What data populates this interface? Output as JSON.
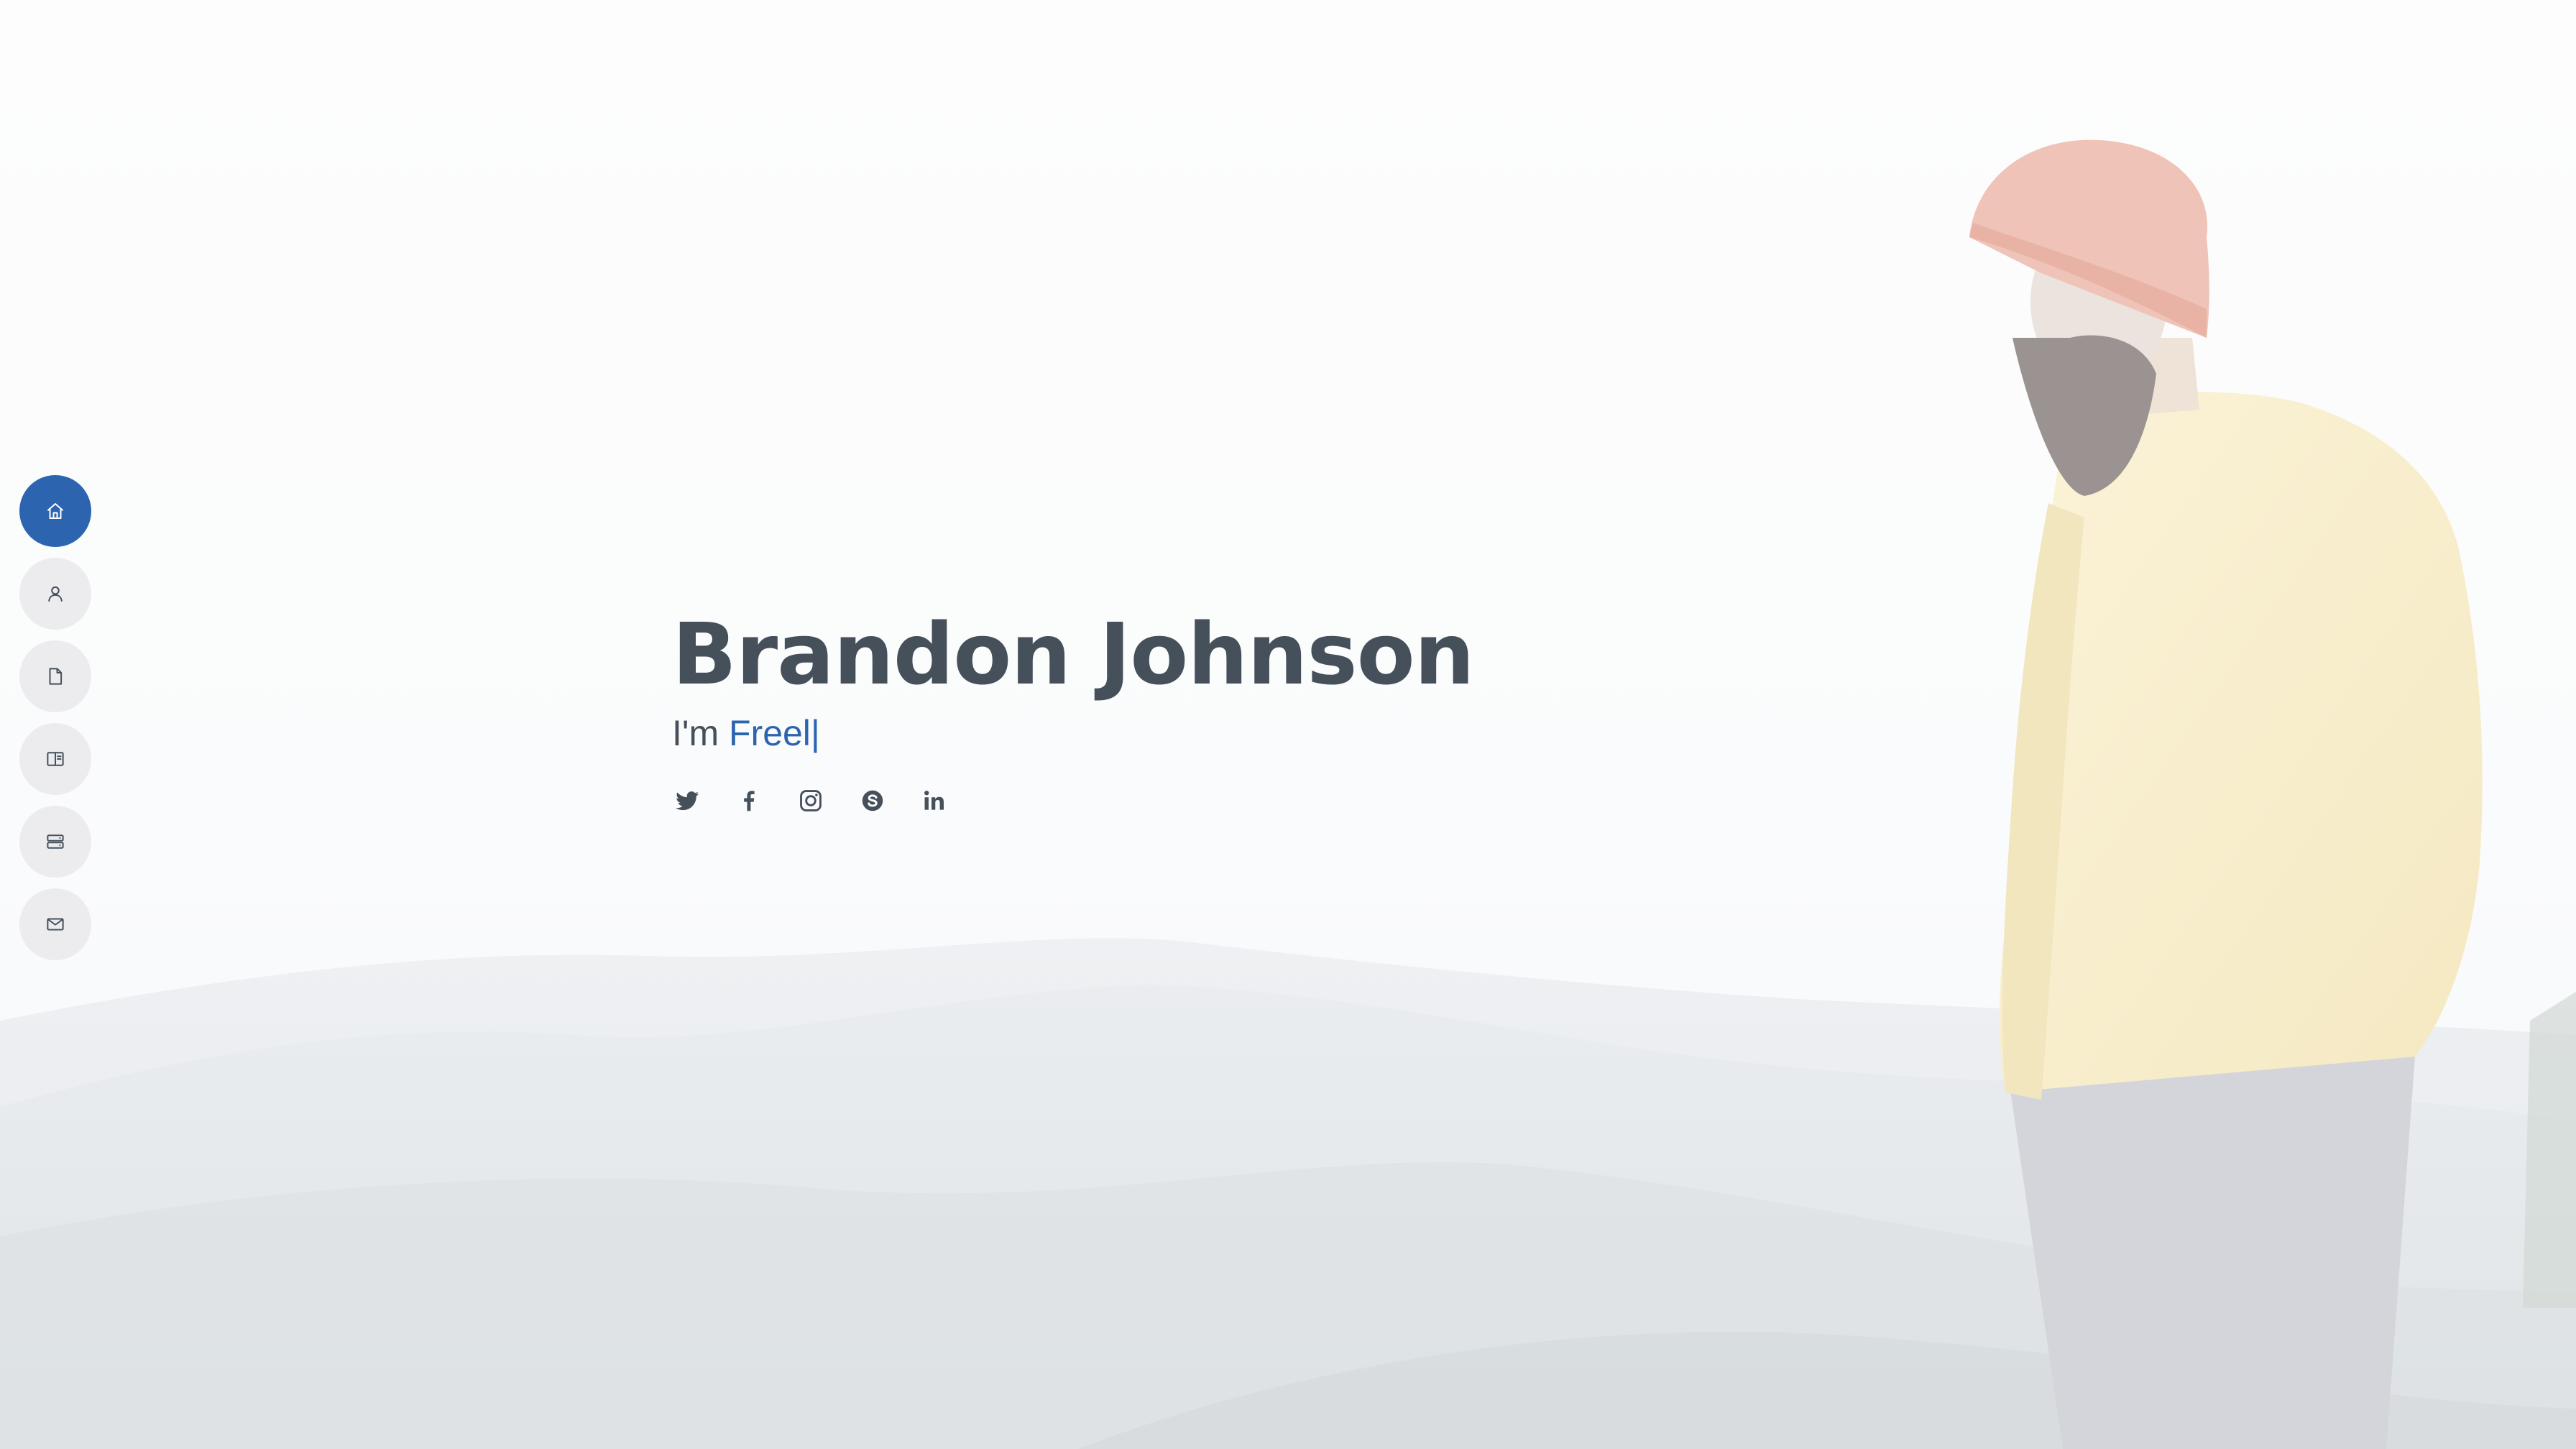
{
  "nav": {
    "items": [
      {
        "icon": "home-icon",
        "active": true
      },
      {
        "icon": "user-icon",
        "active": false
      },
      {
        "icon": "file-icon",
        "active": false
      },
      {
        "icon": "book-icon",
        "active": false
      },
      {
        "icon": "server-icon",
        "active": false
      },
      {
        "icon": "envelope-icon",
        "active": false
      }
    ]
  },
  "hero": {
    "name": "Brandon Johnson",
    "prefix": "I'm",
    "typed": "Freel",
    "caret": "|"
  },
  "socials": [
    {
      "icon": "twitter-icon"
    },
    {
      "icon": "facebook-icon"
    },
    {
      "icon": "instagram-icon"
    },
    {
      "icon": "skype-icon"
    },
    {
      "icon": "linkedin-icon"
    }
  ],
  "colors": {
    "accent": "#2c64b0",
    "text": "#45505b",
    "nav_bg": "#ececef"
  }
}
